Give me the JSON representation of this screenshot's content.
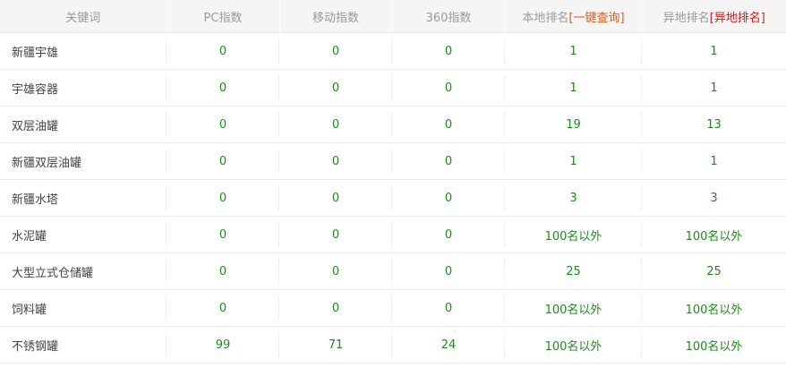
{
  "headers": {
    "keyword": "关键词",
    "pc_index": "PC指数",
    "mobile_index": "移动指数",
    "index_360": "360指数",
    "local_rank": "本地排名",
    "local_query": "[一键查询]",
    "remote_rank": "异地排名",
    "remote_query": "[异地排名]"
  },
  "rows": [
    {
      "keyword": "新疆宇雄",
      "pc": "0",
      "mobile": "0",
      "s360": "0",
      "local": "1",
      "remote": "1"
    },
    {
      "keyword": "宇雄容器",
      "pc": "0",
      "mobile": "0",
      "s360": "0",
      "local": "1",
      "remote": "1"
    },
    {
      "keyword": "双层油罐",
      "pc": "0",
      "mobile": "0",
      "s360": "0",
      "local": "19",
      "remote": "13"
    },
    {
      "keyword": "新疆双层油罐",
      "pc": "0",
      "mobile": "0",
      "s360": "0",
      "local": "1",
      "remote": "1"
    },
    {
      "keyword": "新疆水塔",
      "pc": "0",
      "mobile": "0",
      "s360": "0",
      "local": "3",
      "remote": "3"
    },
    {
      "keyword": "水泥罐",
      "pc": "0",
      "mobile": "0",
      "s360": "0",
      "local": "100名以外",
      "remote": "100名以外"
    },
    {
      "keyword": "大型立式仓储罐",
      "pc": "0",
      "mobile": "0",
      "s360": "0",
      "local": "25",
      "remote": "25"
    },
    {
      "keyword": "饲料罐",
      "pc": "0",
      "mobile": "0",
      "s360": "0",
      "local": "100名以外",
      "remote": "100名以外"
    },
    {
      "keyword": "不锈钢罐",
      "pc": "99",
      "mobile": "71",
      "s360": "24",
      "local": "100名以外",
      "remote": "100名以外"
    }
  ],
  "colors": {
    "header_bg": "#f5f5f5",
    "header_text": "#999999",
    "value_green": "#1e8a1e",
    "query_orange": "#e05a1a",
    "query_red": "#d41e1e"
  }
}
